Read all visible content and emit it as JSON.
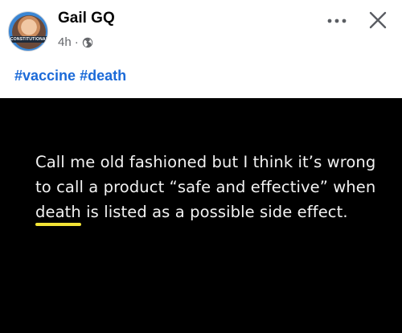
{
  "post": {
    "author": {
      "name": "Gail GQ",
      "avatar_band_text": "CONSTITUTIONAL"
    },
    "timestamp": "4h",
    "separator": "·",
    "privacy_icon": "globe-icon",
    "hashtags": [
      "#vaccine",
      "#death"
    ],
    "image_text": {
      "before": "Call me old fashioned but I think it’s wrong to call a product “safe and effective” when ",
      "highlight": "death",
      "after": " is listed as a possible side effect."
    },
    "actions": {
      "more_icon": "more-icon",
      "close_icon": "close-icon"
    },
    "colors": {
      "hashtag": "#1b6ad8",
      "highlight_underline": "#f2e436",
      "image_background": "#000000"
    }
  }
}
